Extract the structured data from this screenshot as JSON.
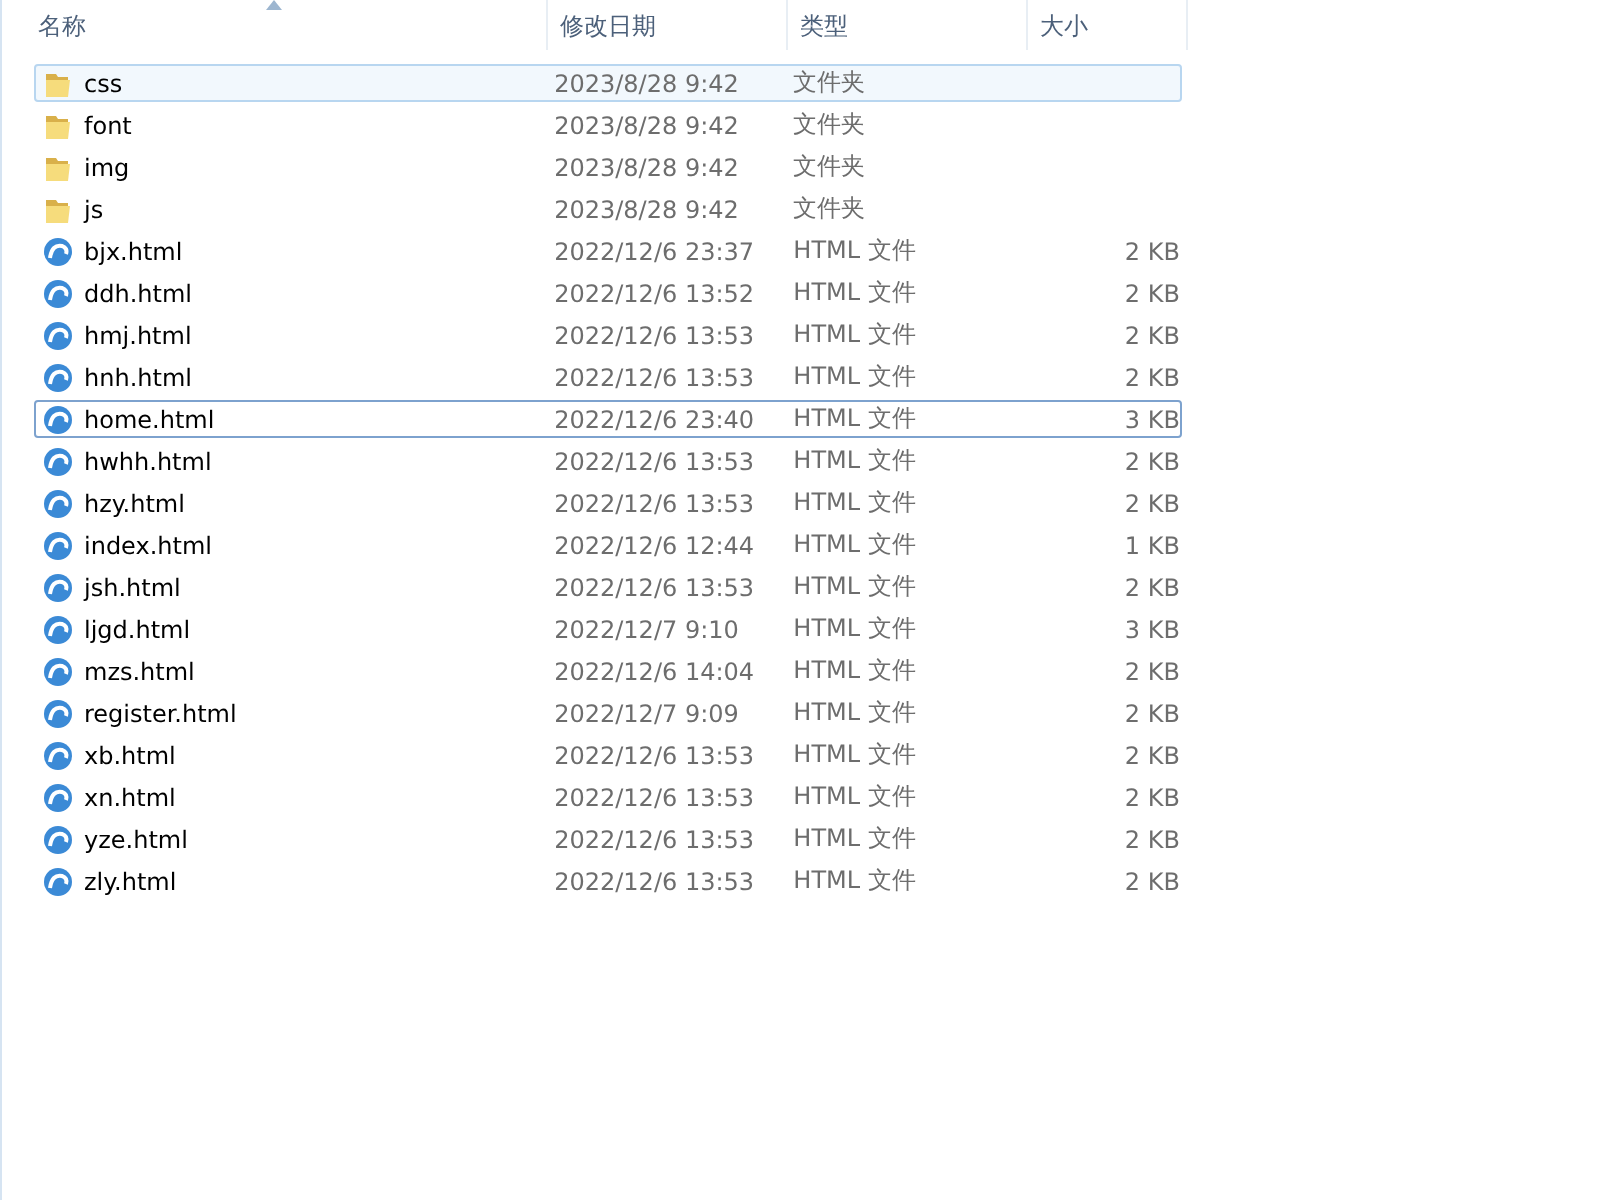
{
  "columns": [
    {
      "label": "名称",
      "sorted": true
    },
    {
      "label": "修改日期",
      "sorted": false
    },
    {
      "label": "类型",
      "sorted": false
    },
    {
      "label": "大小",
      "sorted": false
    }
  ],
  "files": [
    {
      "kind": "folder",
      "name": "css",
      "modified": "2023/8/28 9:42",
      "type": "文件夹",
      "selected": true,
      "focused": false
    },
    {
      "kind": "folder",
      "name": "font",
      "modified": "2023/8/28 9:42",
      "type": "文件夹",
      "selected": false,
      "focused": false
    },
    {
      "kind": "folder",
      "name": "img",
      "modified": "2023/8/28 9:42",
      "type": "文件夹",
      "selected": false,
      "focused": false
    },
    {
      "kind": "folder",
      "name": "js",
      "modified": "2023/8/28 9:42",
      "type": "文件夹",
      "selected": false,
      "focused": false
    },
    {
      "kind": "html",
      "name": "bjx.html",
      "modified": "2022/12/6 23:37",
      "type": "HTML 文件",
      "size": "2 KB",
      "selected": false,
      "focused": false
    },
    {
      "kind": "html",
      "name": "ddh.html",
      "modified": "2022/12/6 13:52",
      "type": "HTML 文件",
      "size": "2 KB",
      "selected": false,
      "focused": false
    },
    {
      "kind": "html",
      "name": "hmj.html",
      "modified": "2022/12/6 13:53",
      "type": "HTML 文件",
      "size": "2 KB",
      "selected": false,
      "focused": false
    },
    {
      "kind": "html",
      "name": "hnh.html",
      "modified": "2022/12/6 13:53",
      "type": "HTML 文件",
      "size": "2 KB",
      "selected": false,
      "focused": false
    },
    {
      "kind": "html",
      "name": "home.html",
      "modified": "2022/12/6 23:40",
      "type": "HTML 文件",
      "size": "3 KB",
      "selected": false,
      "focused": true
    },
    {
      "kind": "html",
      "name": "hwhh.html",
      "modified": "2022/12/6 13:53",
      "type": "HTML 文件",
      "size": "2 KB",
      "selected": false,
      "focused": false
    },
    {
      "kind": "html",
      "name": "hzy.html",
      "modified": "2022/12/6 13:53",
      "type": "HTML 文件",
      "size": "2 KB",
      "selected": false,
      "focused": false
    },
    {
      "kind": "html",
      "name": "index.html",
      "modified": "2022/12/6 12:44",
      "type": "HTML 文件",
      "size": "1 KB",
      "selected": false,
      "focused": false
    },
    {
      "kind": "html",
      "name": "jsh.html",
      "modified": "2022/12/6 13:53",
      "type": "HTML 文件",
      "size": "2 KB",
      "selected": false,
      "focused": false
    },
    {
      "kind": "html",
      "name": "ljgd.html",
      "modified": "2022/12/7 9:10",
      "type": "HTML 文件",
      "size": "3 KB",
      "selected": false,
      "focused": false
    },
    {
      "kind": "html",
      "name": "mzs.html",
      "modified": "2022/12/6 14:04",
      "type": "HTML 文件",
      "size": "2 KB",
      "selected": false,
      "focused": false
    },
    {
      "kind": "html",
      "name": "register.html",
      "modified": "2022/12/7 9:09",
      "type": "HTML 文件",
      "size": "2 KB",
      "selected": false,
      "focused": false
    },
    {
      "kind": "html",
      "name": "xb.html",
      "modified": "2022/12/6 13:53",
      "type": "HTML 文件",
      "size": "2 KB",
      "selected": false,
      "focused": false
    },
    {
      "kind": "html",
      "name": "xn.html",
      "modified": "2022/12/6 13:53",
      "type": "HTML 文件",
      "size": "2 KB",
      "selected": false,
      "focused": false
    },
    {
      "kind": "html",
      "name": "yze.html",
      "modified": "2022/12/6 13:53",
      "type": "HTML 文件",
      "size": "2 KB",
      "selected": false,
      "focused": false
    },
    {
      "kind": "html",
      "name": "zly.html",
      "modified": "2022/12/6 13:53",
      "type": "HTML 文件",
      "size": "2 KB",
      "selected": false,
      "focused": false
    }
  ]
}
